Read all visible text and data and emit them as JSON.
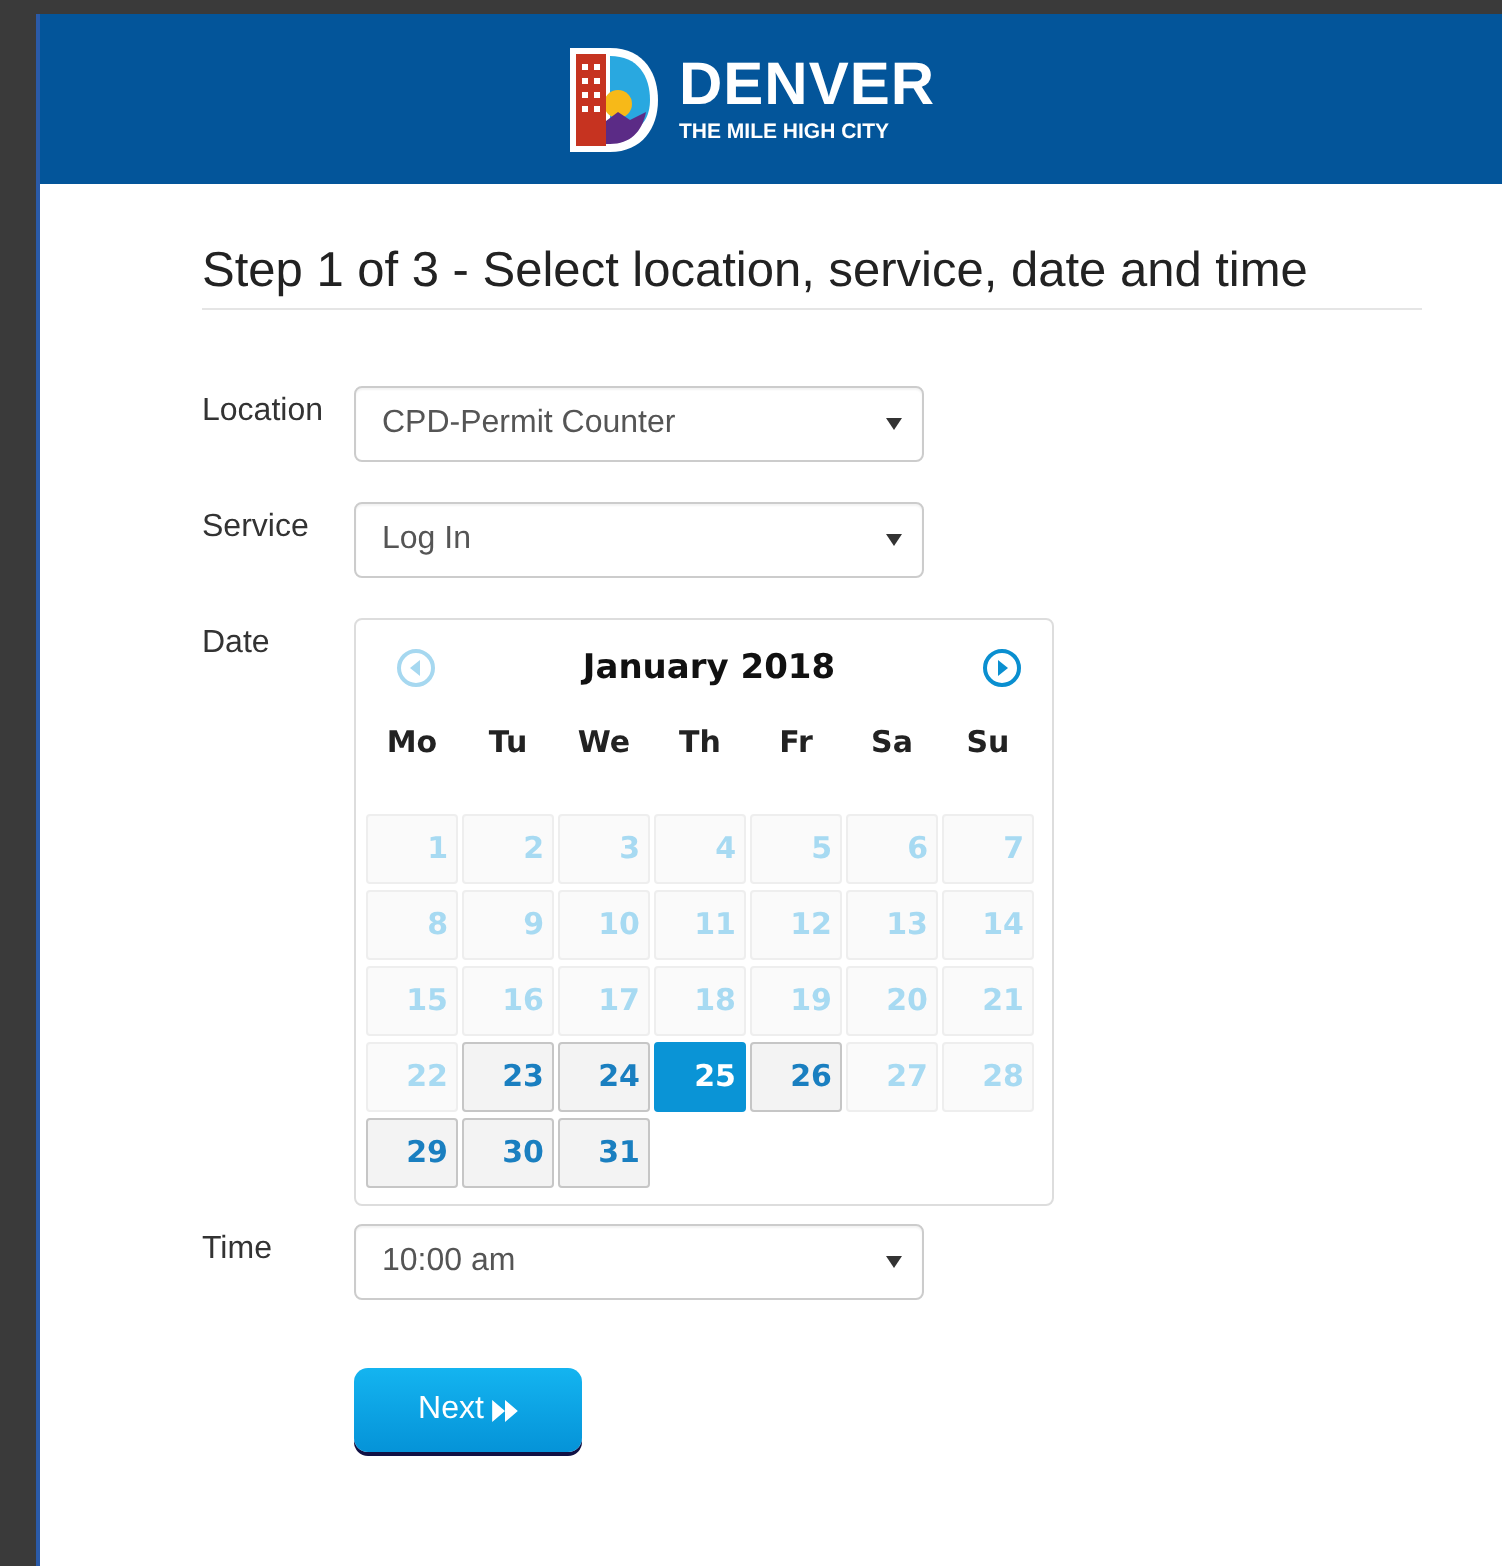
{
  "header": {
    "logo_title": "DENVER",
    "logo_subtitle": "THE MILE HIGH CITY"
  },
  "heading": "Step 1 of 3 - Select location, service, date and time",
  "fields": [
    {
      "kind": "select",
      "label": "Location",
      "value": "CPD-Permit Counter"
    },
    {
      "kind": "select",
      "label": "Service",
      "value": "Log In"
    },
    {
      "kind": "calendar",
      "label": "Date"
    },
    {
      "kind": "select",
      "label": "Time",
      "value": "10:00 am"
    }
  ],
  "calendar": {
    "month": "January 2018",
    "prev_disabled": true,
    "next_disabled": false,
    "weekdays": [
      "Mo",
      "Tu",
      "We",
      "Th",
      "Fr",
      "Sa",
      "Su"
    ],
    "weeks": [
      [
        {
          "day": "1",
          "disabled": true,
          "selected": false
        },
        {
          "day": "2",
          "disabled": true,
          "selected": false
        },
        {
          "day": "3",
          "disabled": true,
          "selected": false
        },
        {
          "day": "4",
          "disabled": true,
          "selected": false
        },
        {
          "day": "5",
          "disabled": true,
          "selected": false
        },
        {
          "day": "6",
          "disabled": true,
          "selected": false
        },
        {
          "day": "7",
          "disabled": true,
          "selected": false
        }
      ],
      [
        {
          "day": "8",
          "disabled": true,
          "selected": false
        },
        {
          "day": "9",
          "disabled": true,
          "selected": false
        },
        {
          "day": "10",
          "disabled": true,
          "selected": false
        },
        {
          "day": "11",
          "disabled": true,
          "selected": false
        },
        {
          "day": "12",
          "disabled": true,
          "selected": false
        },
        {
          "day": "13",
          "disabled": true,
          "selected": false
        },
        {
          "day": "14",
          "disabled": true,
          "selected": false
        }
      ],
      [
        {
          "day": "15",
          "disabled": true,
          "selected": false
        },
        {
          "day": "16",
          "disabled": true,
          "selected": false
        },
        {
          "day": "17",
          "disabled": true,
          "selected": false
        },
        {
          "day": "18",
          "disabled": true,
          "selected": false
        },
        {
          "day": "19",
          "disabled": true,
          "selected": false
        },
        {
          "day": "20",
          "disabled": true,
          "selected": false
        },
        {
          "day": "21",
          "disabled": true,
          "selected": false
        }
      ],
      [
        {
          "day": "22",
          "disabled": true,
          "selected": false
        },
        {
          "day": "23",
          "disabled": false,
          "selected": false
        },
        {
          "day": "24",
          "disabled": false,
          "selected": false
        },
        {
          "day": "25",
          "disabled": false,
          "selected": true
        },
        {
          "day": "26",
          "disabled": false,
          "selected": false
        },
        {
          "day": "27",
          "disabled": true,
          "selected": false
        },
        {
          "day": "28",
          "disabled": true,
          "selected": false
        }
      ],
      [
        {
          "day": "29",
          "disabled": false,
          "selected": false
        },
        {
          "day": "30",
          "disabled": false,
          "selected": false
        },
        {
          "day": "31",
          "disabled": false,
          "selected": false
        }
      ]
    ]
  },
  "next_button": "Next"
}
